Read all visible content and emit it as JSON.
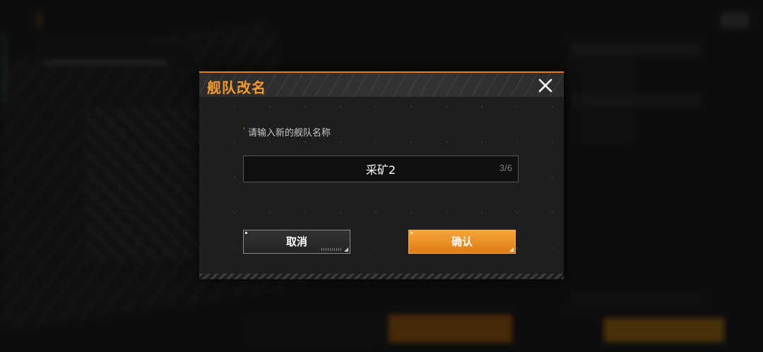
{
  "dialog": {
    "title": "舰队改名",
    "prompt": "请输入新的舰队名称",
    "input_value": "采矿2",
    "char_count": "3/6",
    "cancel_label": "取消",
    "confirm_label": "确认"
  },
  "colors": {
    "accent": "#f39a2a",
    "confirm_bg": "#e88a1e",
    "dialog_bg": "#1e1e1e"
  }
}
